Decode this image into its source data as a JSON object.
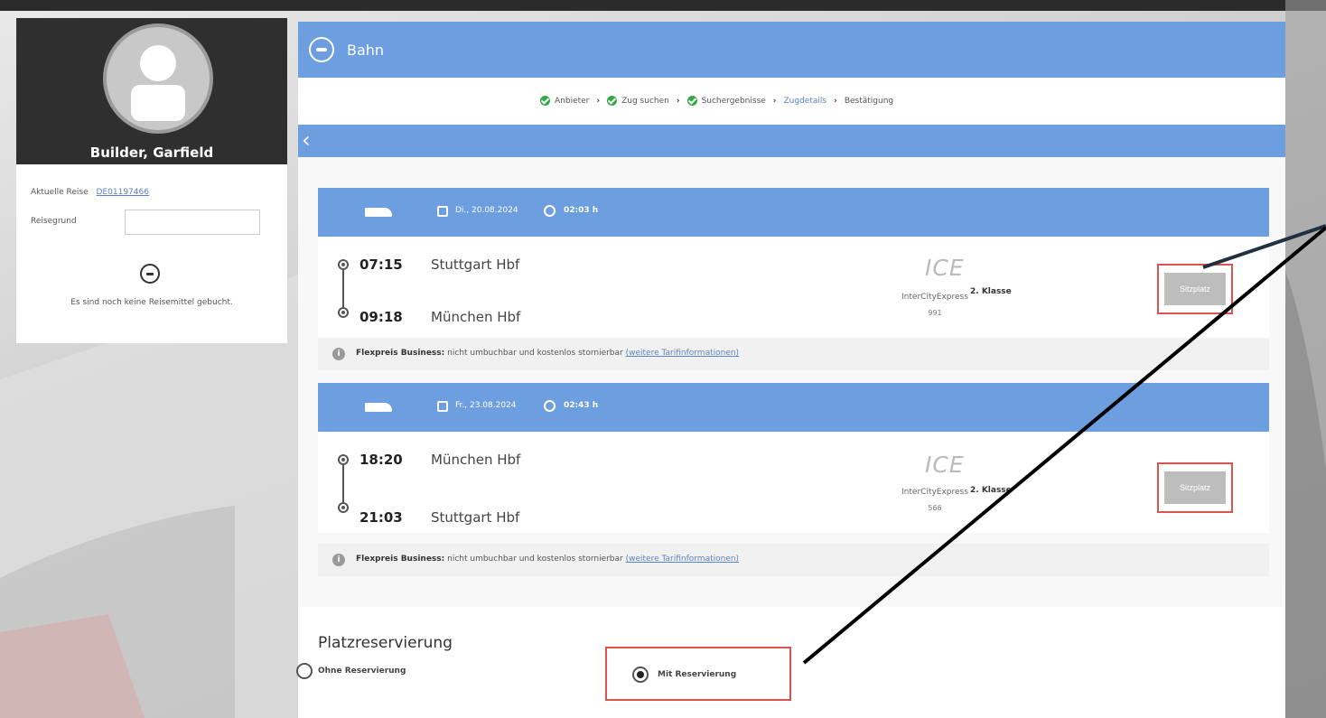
{
  "profile": {
    "name": "Builder, Garfield",
    "current_trip_label": "Aktuelle Reise",
    "current_trip_id": "DE01197466",
    "reason_label": "Reisegrund",
    "reason_value": "",
    "no_booking_text": "Es sind noch keine Reisemittel gebucht."
  },
  "header": {
    "title": "Bahn"
  },
  "breadcrumb": [
    {
      "label": "Anbieter",
      "done": true
    },
    {
      "label": "Zug suchen",
      "done": true
    },
    {
      "label": "Suchergebnisse",
      "done": true
    },
    {
      "label": "Zugdetails",
      "active": true
    },
    {
      "label": "Bestätigung"
    }
  ],
  "trips": [
    {
      "date": "Di., 20.08.2024",
      "duration": "02:03 h",
      "dep_time": "07:15",
      "dep_station": "Stuttgart Hbf",
      "arr_time": "09:18",
      "arr_station": "München Hbf",
      "train_type": "ICE",
      "train_name": "InterCityExpress",
      "train_number": "991",
      "class": "2. Klasse",
      "seat_button": "Sitzplatz",
      "fare_name": "Flexpreis Business:",
      "fare_text": "nicht umbuchbar und kostenlos stornierbar",
      "fare_link": "(weitere Tarifinformationen)"
    },
    {
      "date": "Fr., 23.08.2024",
      "duration": "02:43 h",
      "dep_time": "18:20",
      "dep_station": "München Hbf",
      "arr_time": "21:03",
      "arr_station": "Stuttgart Hbf",
      "train_type": "ICE",
      "train_name": "InterCityExpress",
      "train_number": "566",
      "class": "2. Klasse",
      "seat_button": "Sitzplatz",
      "fare_name": "Flexpreis Business:",
      "fare_text": "nicht umbuchbar und kostenlos stornierbar",
      "fare_link": "(weitere Tarifinformationen)"
    }
  ],
  "reservation": {
    "title": "Platzreservierung",
    "option_none": "Ohne Reservierung",
    "option_with": "Mit Reservierung",
    "selected": "with"
  },
  "icons": {
    "back": "chevron-left-icon",
    "logo": "bahn-logo-icon",
    "train": "train-icon",
    "calendar": "calendar-icon",
    "clock": "clock-icon",
    "info": "info-icon",
    "check": "check-circle-icon"
  },
  "colors": {
    "accent": "#6c9ee0",
    "highlight": "#d9534f",
    "check": "#35a846",
    "link": "#5a83c8"
  }
}
